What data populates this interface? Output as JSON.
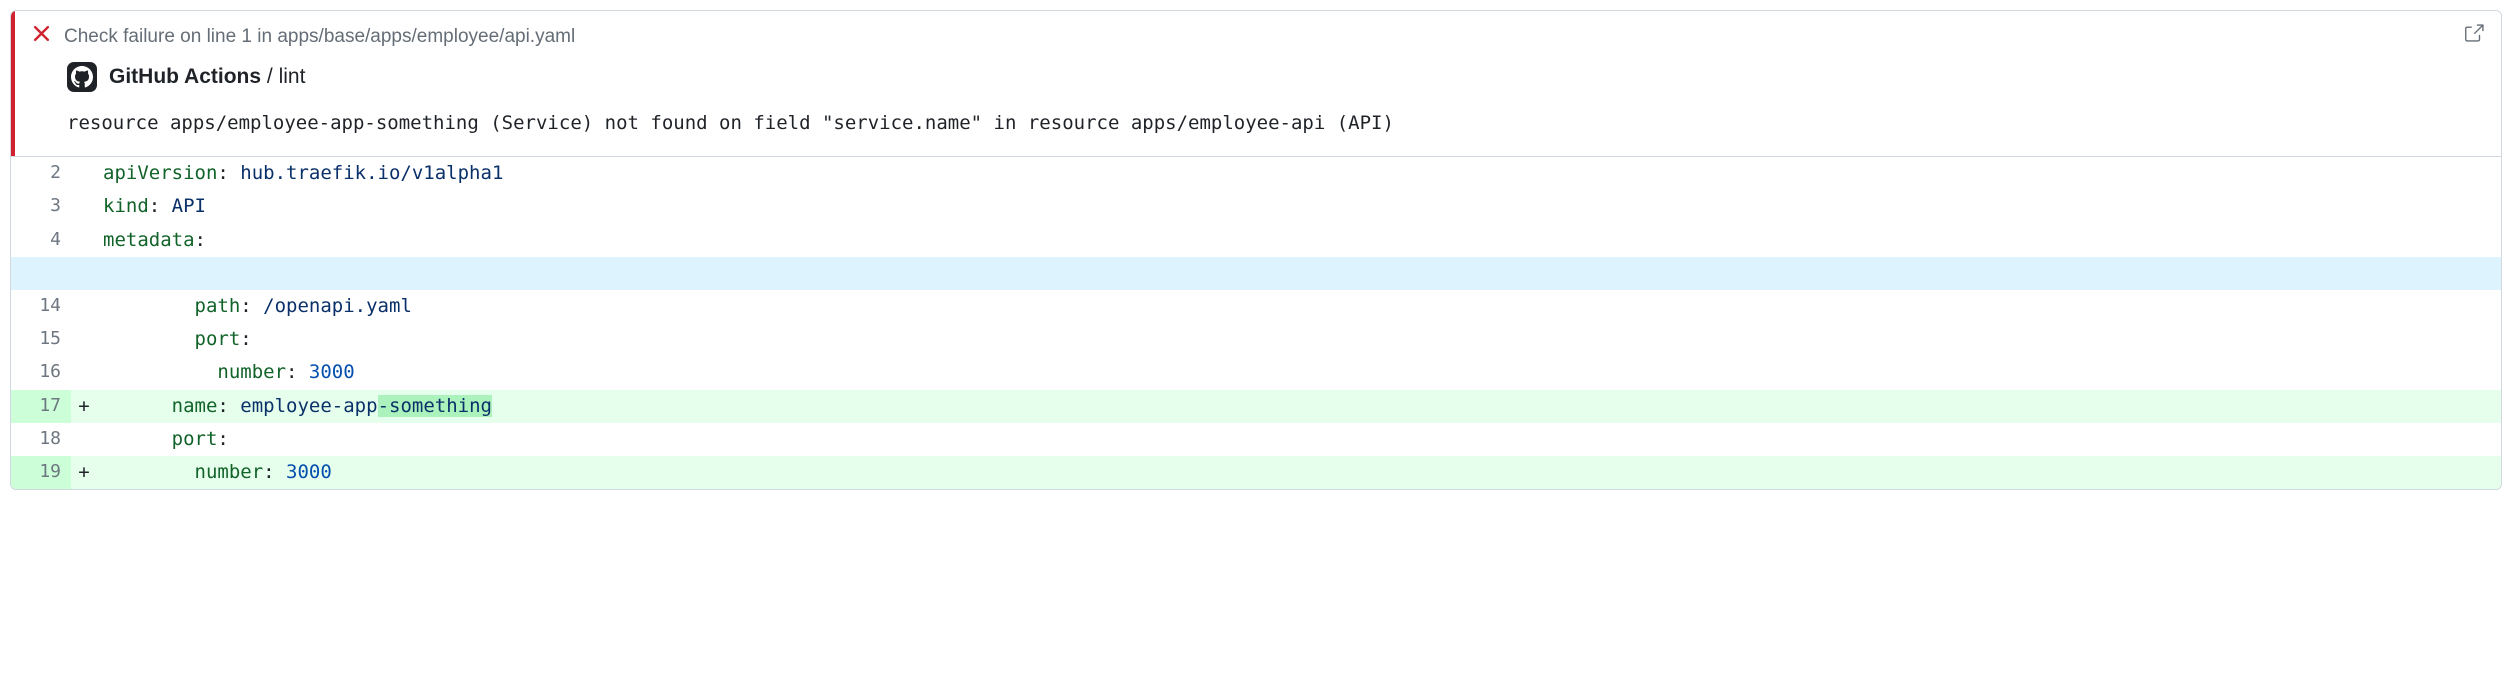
{
  "annotation": {
    "header_text": "Check failure on line 1 in apps/base/apps/employee/api.yaml",
    "source_bold": "GitHub Actions",
    "source_separator": " / ",
    "source_name": "lint",
    "message": "resource apps/employee-app-something (Service) not found on field \"service.name\" in resource apps/employee-api (API)"
  },
  "code": {
    "lines": [
      {
        "num": "2",
        "marker": "",
        "type": "context",
        "tokens": [
          {
            "cls": "tok-key",
            "t": "apiVersion"
          },
          {
            "cls": "",
            "t": ": "
          },
          {
            "cls": "tok-str",
            "t": "hub.traefik.io/v1alpha1"
          }
        ]
      },
      {
        "num": "3",
        "marker": "",
        "type": "context",
        "tokens": [
          {
            "cls": "tok-key",
            "t": "kind"
          },
          {
            "cls": "",
            "t": ": "
          },
          {
            "cls": "tok-str",
            "t": "API"
          }
        ]
      },
      {
        "num": "4",
        "marker": "",
        "type": "context",
        "tokens": [
          {
            "cls": "tok-key",
            "t": "metadata"
          },
          {
            "cls": "",
            "t": ":"
          }
        ]
      },
      {
        "num": "",
        "marker": "",
        "type": "hunk",
        "tokens": []
      },
      {
        "num": "14",
        "marker": "",
        "type": "context",
        "tokens": [
          {
            "cls": "",
            "t": "        "
          },
          {
            "cls": "tok-key",
            "t": "path"
          },
          {
            "cls": "",
            "t": ": "
          },
          {
            "cls": "tok-str",
            "t": "/openapi.yaml"
          }
        ]
      },
      {
        "num": "15",
        "marker": "",
        "type": "context",
        "tokens": [
          {
            "cls": "",
            "t": "        "
          },
          {
            "cls": "tok-key",
            "t": "port"
          },
          {
            "cls": "",
            "t": ":"
          }
        ]
      },
      {
        "num": "16",
        "marker": "",
        "type": "context",
        "tokens": [
          {
            "cls": "",
            "t": "          "
          },
          {
            "cls": "tok-key",
            "t": "number"
          },
          {
            "cls": "",
            "t": ": "
          },
          {
            "cls": "tok-num",
            "t": "3000"
          }
        ]
      },
      {
        "num": "17",
        "marker": "+",
        "type": "added",
        "tokens": [
          {
            "cls": "",
            "t": "      "
          },
          {
            "cls": "tok-key",
            "t": "name"
          },
          {
            "cls": "",
            "t": ": "
          },
          {
            "cls": "tok-str",
            "t": "employee-app"
          },
          {
            "cls": "tok-str highlight-add",
            "t": "-something"
          }
        ]
      },
      {
        "num": "18",
        "marker": "",
        "type": "context",
        "tokens": [
          {
            "cls": "",
            "t": "      "
          },
          {
            "cls": "tok-key",
            "t": "port"
          },
          {
            "cls": "",
            "t": ":"
          }
        ]
      },
      {
        "num": "19",
        "marker": "+",
        "type": "added",
        "tokens": [
          {
            "cls": "",
            "t": "        "
          },
          {
            "cls": "tok-key",
            "t": "number"
          },
          {
            "cls": "",
            "t": ": "
          },
          {
            "cls": "tok-num",
            "t": "3000"
          }
        ]
      }
    ]
  }
}
